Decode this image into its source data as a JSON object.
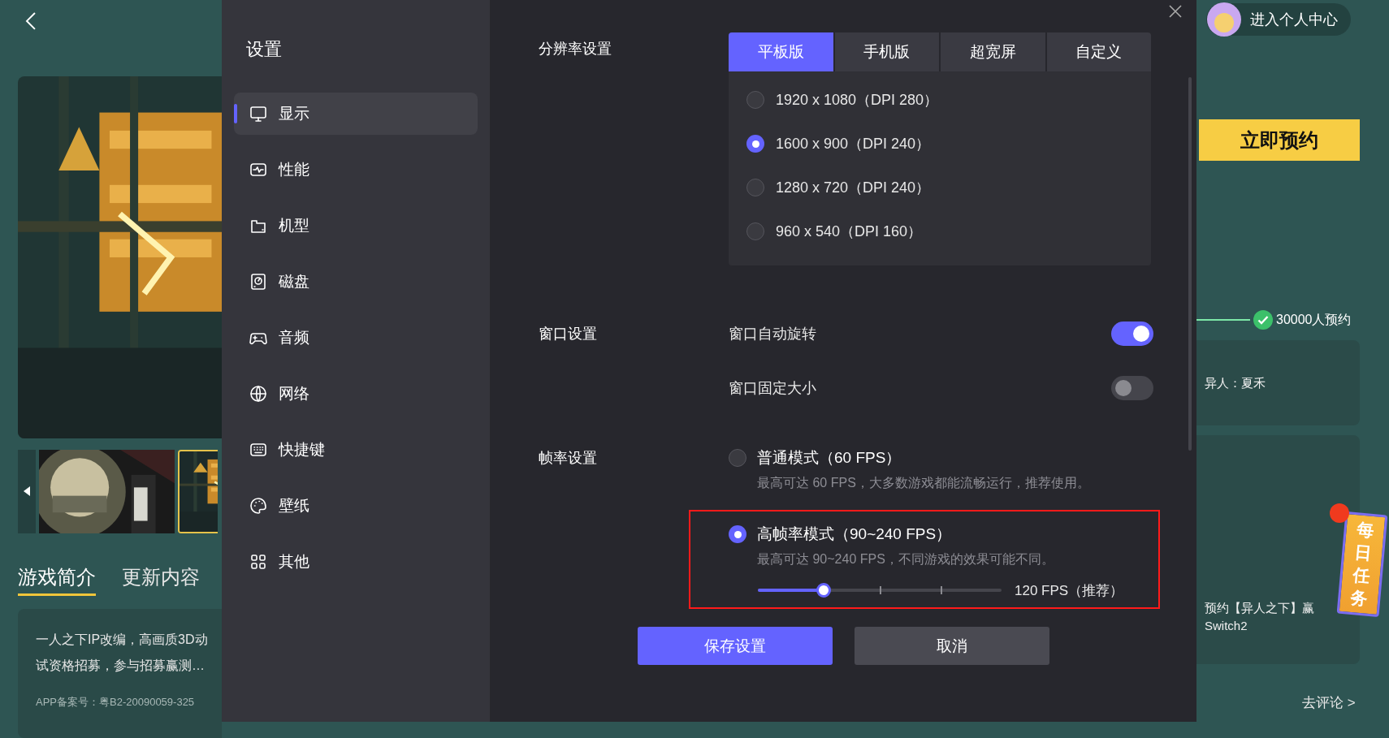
{
  "game_page": {
    "tabs": [
      {
        "label": "游戏简介",
        "selected": true
      },
      {
        "label": "更新内容",
        "selected": false
      }
    ],
    "description": [
      "一人之下IP改编，高画质3D动",
      "试资格招募，参与招募赢测…"
    ],
    "record": "APP备案号：粤B2-20090059-325",
    "profile_button": "进入个人中心",
    "reserve_button": "立即预约",
    "reserve_count": "30000人预约",
    "cards": [
      {
        "lines": [
          "异人：夏禾"
        ]
      },
      {
        "lines": [
          "预约【异人之下】赢",
          "Switch2"
        ]
      }
    ],
    "daily_task": "每日任务",
    "comment_link": "去评论 >"
  },
  "settings": {
    "title": "设置",
    "nav": [
      {
        "label": "显示",
        "selected": true
      },
      {
        "label": "性能",
        "selected": false
      },
      {
        "label": "机型",
        "selected": false
      },
      {
        "label": "磁盘",
        "selected": false
      },
      {
        "label": "音频",
        "selected": false
      },
      {
        "label": "网络",
        "selected": false
      },
      {
        "label": "快捷键",
        "selected": false
      },
      {
        "label": "壁纸",
        "selected": false
      },
      {
        "label": "其他",
        "selected": false
      }
    ],
    "resolution": {
      "label": "分辨率设置",
      "tabs": [
        {
          "label": "平板版",
          "selected": true
        },
        {
          "label": "手机版",
          "selected": false
        },
        {
          "label": "超宽屏",
          "selected": false
        },
        {
          "label": "自定义",
          "selected": false
        }
      ],
      "options": [
        {
          "label": "1920 x 1080（DPI 280）",
          "selected": false
        },
        {
          "label": "1600 x 900（DPI 240）",
          "selected": true
        },
        {
          "label": "1280 x 720（DPI 240）",
          "selected": false
        },
        {
          "label": "960 x 540（DPI 160）",
          "selected": false
        }
      ]
    },
    "window": {
      "label": "窗口设置",
      "toggles": [
        {
          "label": "窗口自动旋转",
          "on": true
        },
        {
          "label": "窗口固定大小",
          "on": false
        }
      ]
    },
    "frame_rate": {
      "label": "帧率设置",
      "modes": [
        {
          "title": "普通模式（60 FPS）",
          "hint": "最高可达 60 FPS，大多数游戏都能流畅运行，推荐使用。",
          "selected": false,
          "highlighted": false
        },
        {
          "title": "高帧率模式（90~240 FPS）",
          "hint": "最高可达 90~240 FPS，不同游戏的效果可能不同。",
          "selected": true,
          "highlighted": true,
          "slider": {
            "level": 0.27,
            "reading": "120 FPS（推荐）"
          }
        }
      ]
    },
    "buttons": [
      {
        "label": "保存设置",
        "kind": "primary"
      },
      {
        "label": "取消",
        "kind": "secondary"
      }
    ]
  }
}
